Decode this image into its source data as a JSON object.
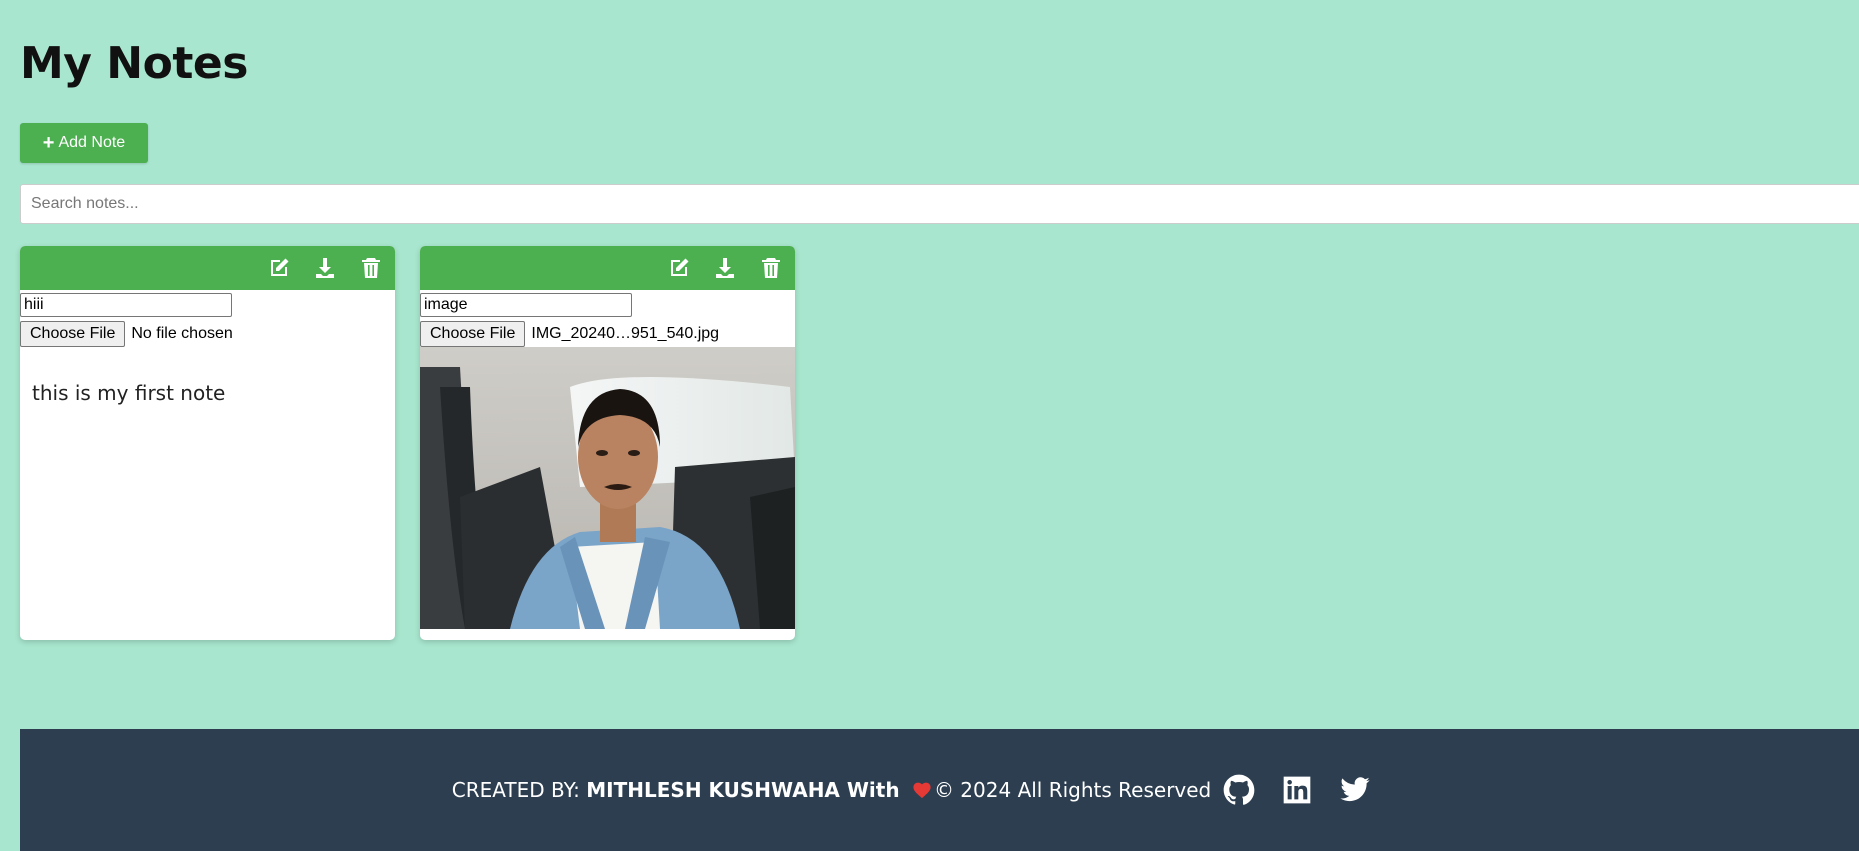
{
  "header": {
    "title": "My Notes",
    "add_note_label": "Add Note"
  },
  "search": {
    "placeholder": "Search notes..."
  },
  "notes": [
    {
      "title": "hiii",
      "choose_file_label": "Choose File",
      "file_status": "No file chosen",
      "content": "this is my first note"
    },
    {
      "title": "image",
      "choose_file_label": "Choose File",
      "file_status": "IMG_20240…951_540.jpg"
    }
  ],
  "footer": {
    "created_by": "CREATED BY: ",
    "author": "MITHLESH KUSHWAHA With",
    "rights": "© 2024 All Rights Reserved"
  },
  "icons": {
    "note_tools": [
      "edit-icon",
      "download-icon",
      "trash-icon"
    ],
    "social": [
      "github-icon",
      "linkedin-icon",
      "twitter-icon"
    ],
    "heart": "heart-icon"
  },
  "colors": {
    "background": "#a8e6cf",
    "accent": "#4caf50",
    "footer": "#2c3e50",
    "heart": "#e53935"
  }
}
